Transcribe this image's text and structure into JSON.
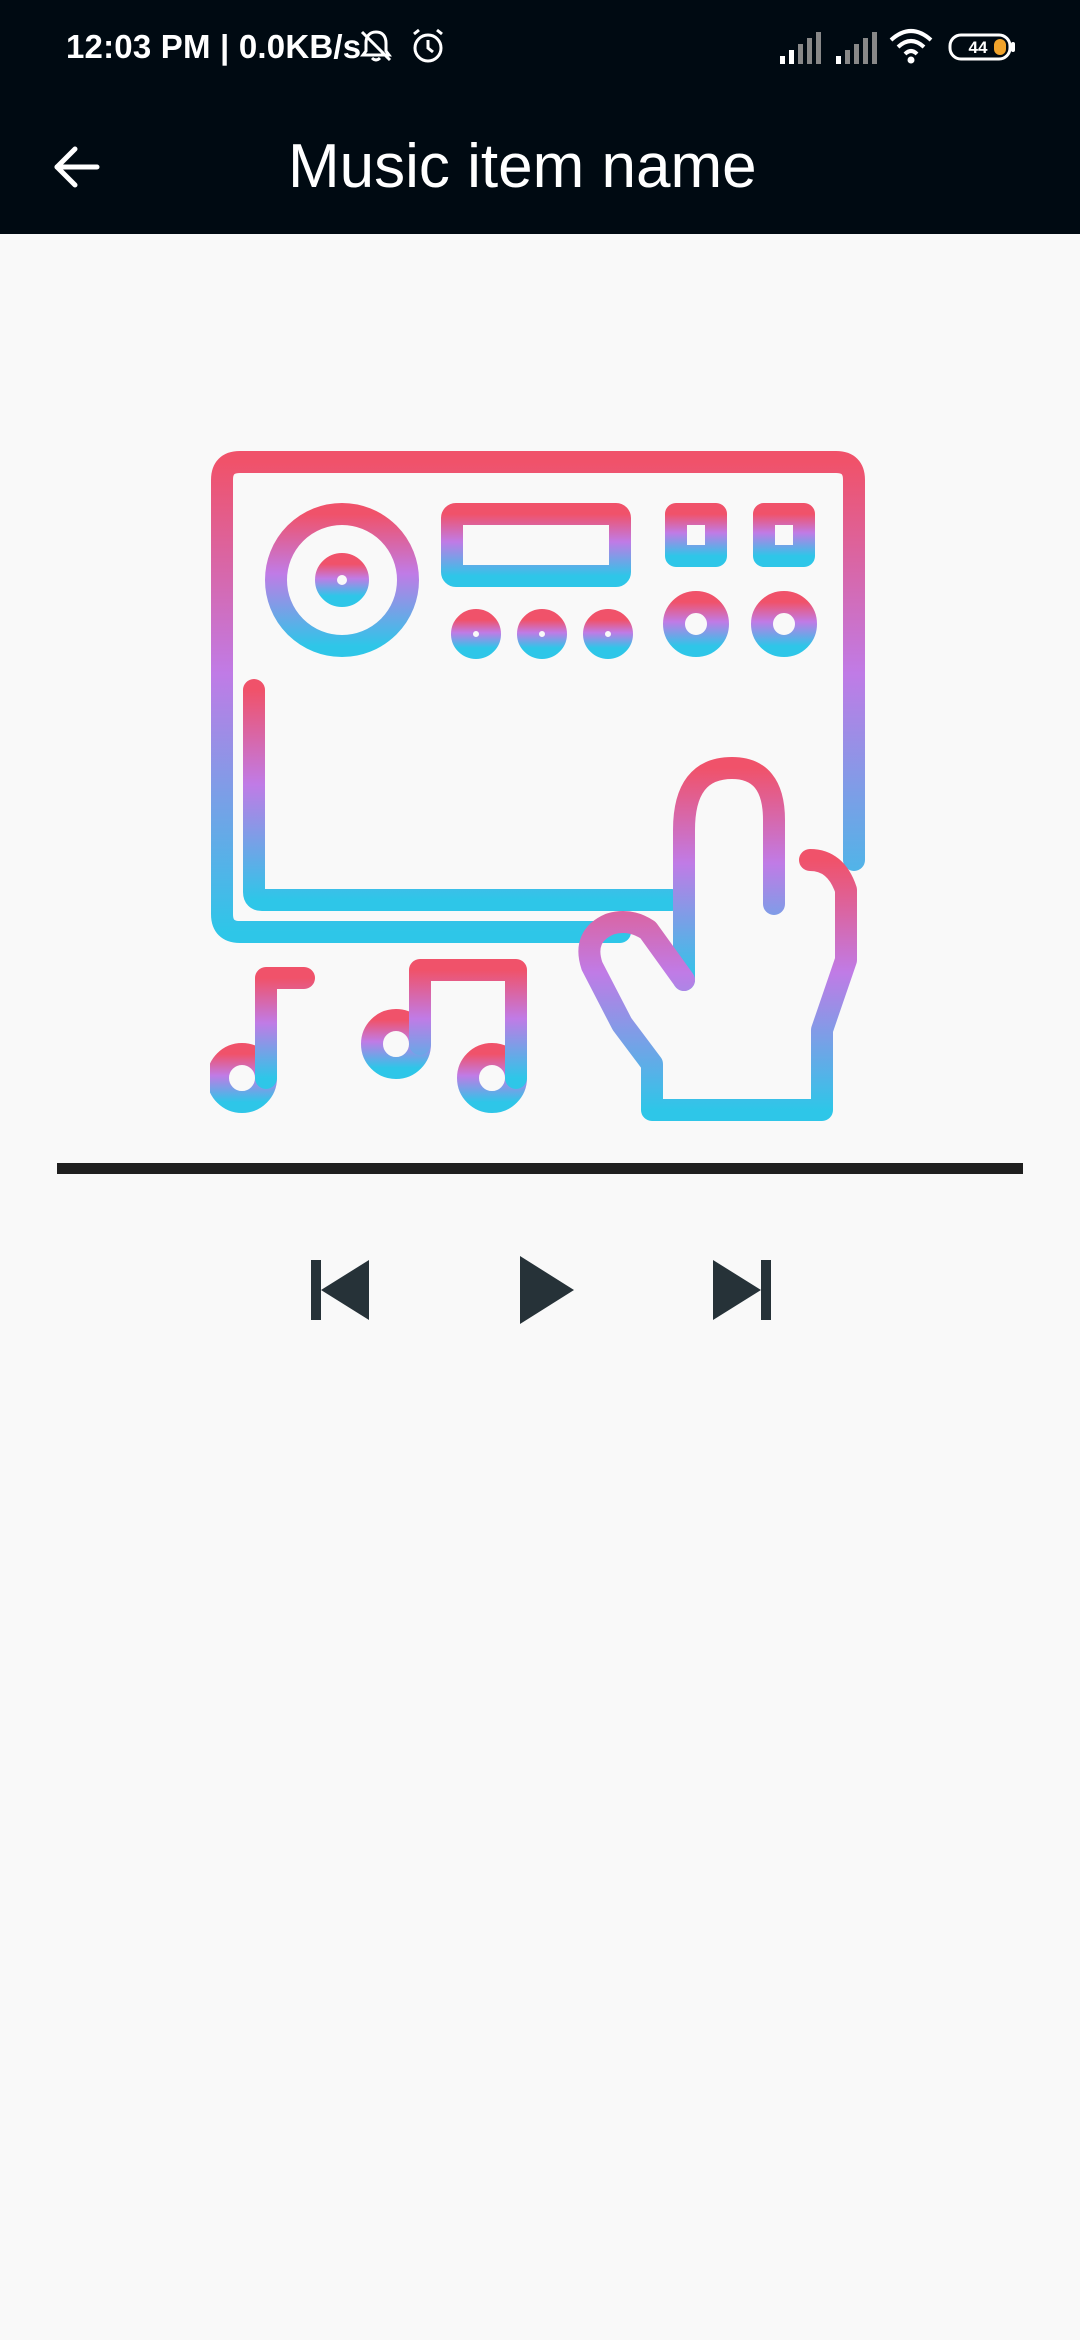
{
  "status_bar": {
    "time_speed": "12:03 PM | 0.0KB/s",
    "battery_level": "44",
    "icons": [
      "mute-bell-icon",
      "alarm-icon",
      "signal-icon",
      "signal-icon",
      "wifi-icon",
      "battery-icon"
    ]
  },
  "app_bar": {
    "title": "Music item name",
    "back_icon": "arrow-left-icon"
  },
  "player": {
    "artwork_icon": "synthesizer-keyboard-hand-music-notes-icon",
    "seek_progress": 1.0,
    "controls": {
      "previous_icon": "skip-previous-icon",
      "play_icon": "play-icon",
      "next_icon": "skip-next-icon"
    }
  },
  "colors": {
    "bar_background": "#000a12",
    "page_background": "#f9f9f9",
    "control_color": "#263238",
    "seek_color": "#1f1f1f",
    "gradient_top": "#f0526a",
    "gradient_mid": "#c07be6",
    "gradient_bottom": "#2ec6e8"
  }
}
